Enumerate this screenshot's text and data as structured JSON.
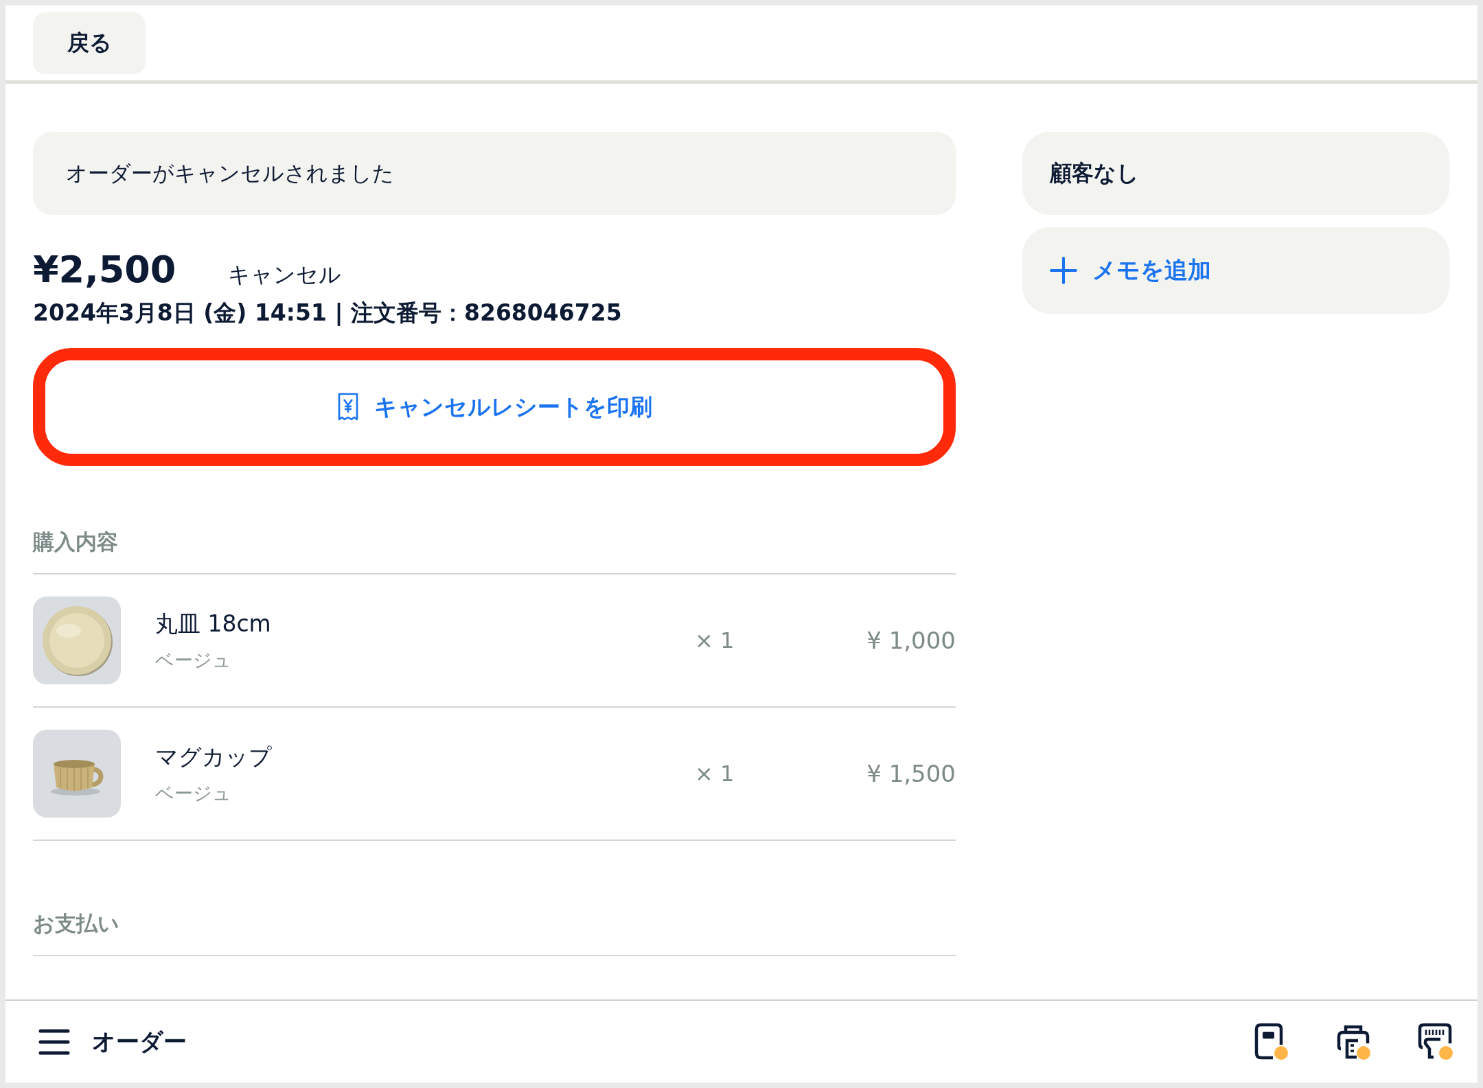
{
  "header": {
    "back_button": "戻る"
  },
  "status_notice": "オーダーがキャンセルされました",
  "order": {
    "total": "¥2,500",
    "status": "キャンセル",
    "meta": "2024年3月8日 (金) 14:51 | 注文番号：8268046725"
  },
  "print_button": {
    "label": "キャンセルレシートを印刷",
    "highlighted": true
  },
  "purchase": {
    "heading": "購入内容",
    "items": [
      {
        "name": "丸皿 18cm",
        "variant": "ベージュ",
        "quantity": "× 1",
        "price": "¥ 1,000",
        "kind": "plate"
      },
      {
        "name": "マグカップ",
        "variant": "ベージュ",
        "quantity": "× 1",
        "price": "¥ 1,500",
        "kind": "cup"
      }
    ]
  },
  "payment": {
    "heading": "お支払い"
  },
  "customer": "顧客なし",
  "memo_button": "メモを追加",
  "bottom_bar": {
    "title": "オーダー",
    "devices": [
      {
        "kind": "reader",
        "alert": true
      },
      {
        "kind": "printer",
        "alert": true
      },
      {
        "kind": "scanner",
        "alert": true
      }
    ]
  }
}
